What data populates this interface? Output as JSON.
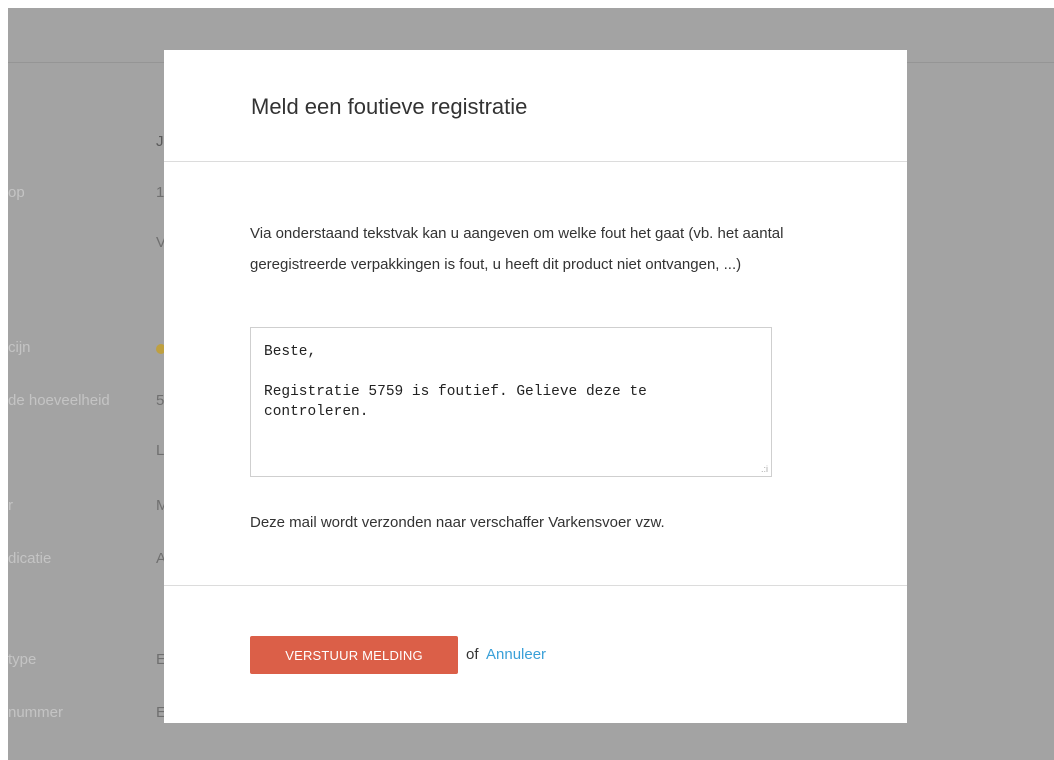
{
  "background": {
    "rows": [
      {
        "label": "",
        "value": "J"
      },
      {
        "label": "op",
        "value": "1"
      },
      {
        "label": "",
        "value": "V"
      },
      {
        "label": "cijn",
        "value": ""
      },
      {
        "label": "de hoeveelheid",
        "value": "5"
      },
      {
        "label": "",
        "value": "L"
      },
      {
        "label": "r",
        "value": "M"
      },
      {
        "label": "dicatie",
        "value": "A"
      },
      {
        "label": "type",
        "value": "E"
      },
      {
        "label": "nummer",
        "value": "E"
      }
    ]
  },
  "modal": {
    "title": "Meld een foutieve registratie",
    "intro": "Via onderstaand tekstvak kan u aangeven om welke fout het gaat (vb. het aantal geregistreerde verpakkingen is fout, u heeft dit product niet ontvangen, ...)",
    "message": "Beste,\n\nRegistratie 5759 is foutief. Gelieve deze te controleren.",
    "note": "Deze mail wordt verzonden naar verschaffer Varkensvoer vzw.",
    "send_label": "Verstuur melding",
    "or_label": "of",
    "cancel_label": "Annuleer"
  },
  "colors": {
    "overlay": "#a3a3a3",
    "primary_button": "#db5f48",
    "link": "#3aa0d8"
  }
}
